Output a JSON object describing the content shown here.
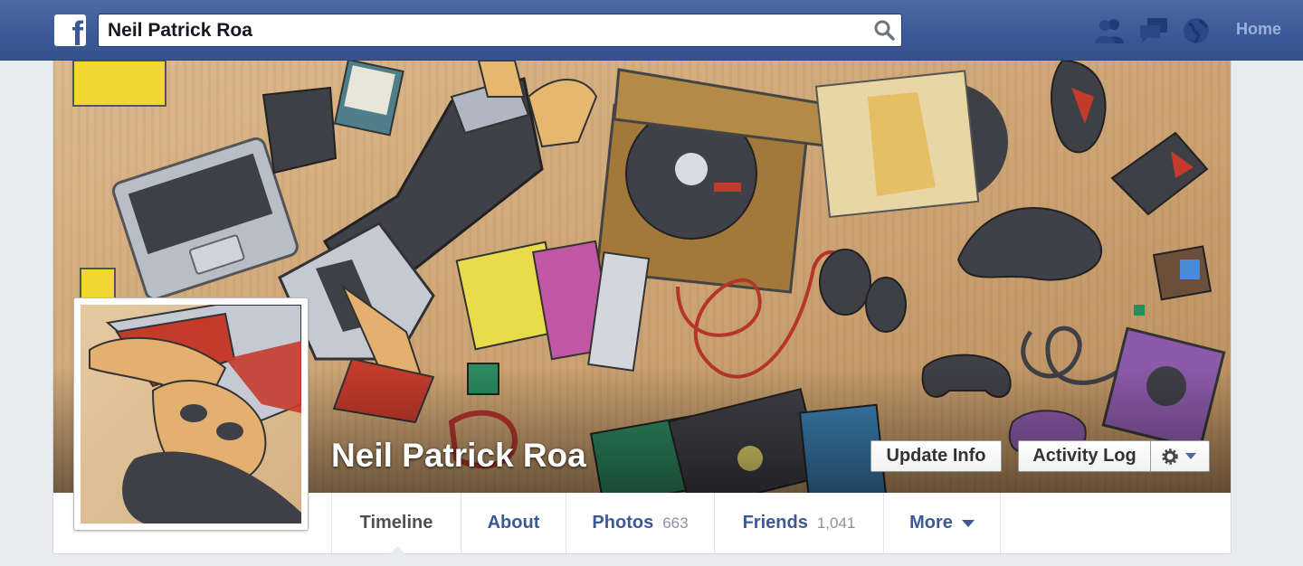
{
  "topbar": {
    "logo_icon": "facebook-logo-icon",
    "logo_glyph": "f",
    "search_value": "Neil Patrick Roa",
    "search_icon": "search-icon",
    "icons": [
      "friend-requests-icon",
      "messages-icon",
      "notifications-globe-icon"
    ],
    "home_label": "Home"
  },
  "profile": {
    "name": "Neil Patrick Roa",
    "update_info_label": "Update Info",
    "activity_log_label": "Activity Log",
    "gear_icon": "gear-icon"
  },
  "tabs": [
    {
      "label": "Timeline",
      "count": ""
    },
    {
      "label": "About",
      "count": ""
    },
    {
      "label": "Photos",
      "count": "663"
    },
    {
      "label": "Friends",
      "count": "1,041"
    },
    {
      "label": "More",
      "count": ""
    }
  ],
  "colors": {
    "brand_blue": "#3b5998",
    "topbar_text": "#9bb0db",
    "page_bg": "#e9ebee"
  }
}
